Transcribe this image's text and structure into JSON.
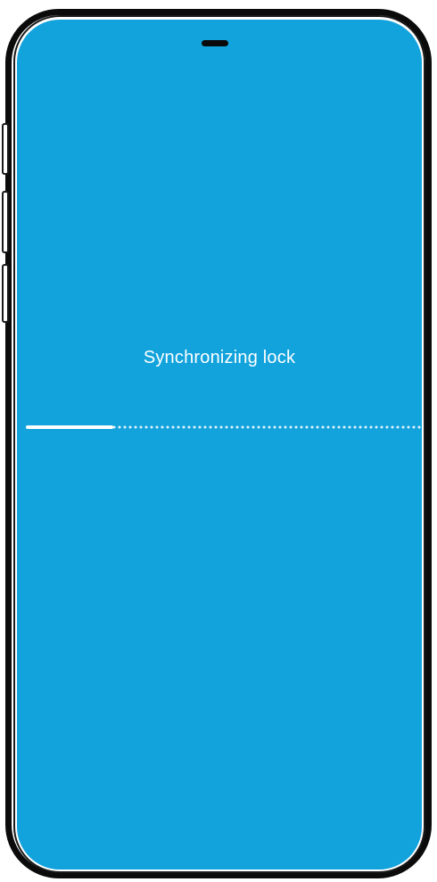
{
  "colors": {
    "screen_background": "#12a3dd",
    "text": "#ffffff",
    "frame": "#0b0b0b"
  },
  "sync_screen": {
    "status_text": "Synchronizing lock",
    "progress_fraction": 0.22
  }
}
